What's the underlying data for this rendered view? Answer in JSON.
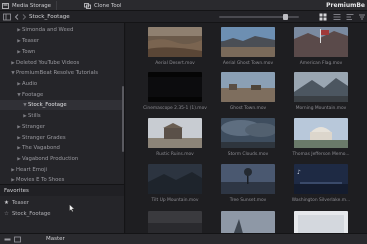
{
  "toolbar": {
    "media_storage_label": "Media Storage",
    "clone_tool_label": "Clone Tool",
    "brand": "PremiumBe"
  },
  "breadcrumb": {
    "current_folder": "Stock_Footage"
  },
  "sidebar": {
    "items": [
      {
        "label": "Simonda and Weed",
        "expanded": false
      },
      {
        "label": "Teaser",
        "expanded": false
      },
      {
        "label": "Town",
        "expanded": false
      },
      {
        "label": "Deleted YouTube Videos",
        "expanded": false
      },
      {
        "label": "PremiumBeat Resolve Tutorials",
        "expanded": true
      },
      {
        "label": "Audio",
        "expanded": false
      },
      {
        "label": "Footage",
        "expanded": true
      },
      {
        "label": "Stock_Footage",
        "expanded": true,
        "selected": true
      },
      {
        "label": "Stills",
        "expanded": false
      },
      {
        "label": "Stranger",
        "expanded": false
      },
      {
        "label": "Stranger Grades",
        "expanded": false
      },
      {
        "label": "The Vagabond",
        "expanded": false
      },
      {
        "label": "Vagabond Production",
        "expanded": false
      },
      {
        "label": "Heart Emoji",
        "expanded": false
      },
      {
        "label": "Movies E To Shoes",
        "expanded": false
      }
    ]
  },
  "favorites": {
    "header": "Favorites",
    "items": [
      {
        "label": "Teaser"
      },
      {
        "label": "Stock_Footage"
      }
    ]
  },
  "clips": [
    {
      "name": "Aerial Desert.mov"
    },
    {
      "name": "Aerial Ghost Town.mov"
    },
    {
      "name": "American Flag.mov"
    },
    {
      "name": "Cinemascope 2.35-1 (1).mov"
    },
    {
      "name": "Ghost Town.mov"
    },
    {
      "name": "Morning Mountain.mov"
    },
    {
      "name": "Rustic Ruins.mov"
    },
    {
      "name": "Storm Clouds.mov"
    },
    {
      "name": "Thomas Jefferson Memo..."
    },
    {
      "name": "Tilt Up Mountain.mov"
    },
    {
      "name": "Tree Sunset.mov"
    },
    {
      "name": "Washington Silverlake.m..."
    }
  ],
  "bottom_bar": {
    "label": "Master"
  },
  "colors": {
    "background": "#1c1c1f",
    "panel": "#252529",
    "toolbar": "#2a2a2e",
    "text": "#b9b9bd",
    "selection": "#303036"
  }
}
